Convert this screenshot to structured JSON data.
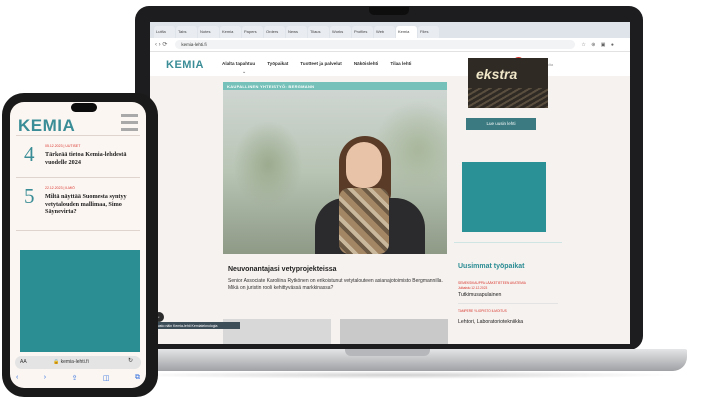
{
  "browser": {
    "tabs": [
      "Lutfia",
      "Tabs",
      "Notes",
      "Kemia",
      "Papers",
      "Orders",
      "News",
      "Tilaus",
      "Works",
      "Profiles",
      "Web",
      "Kemia",
      "Files"
    ],
    "url": "kemia-lehti.fi",
    "nav_glyphs": "‹ › ⟳",
    "toolbar_glyphs": "☆ ⊕ ▣ ●"
  },
  "site": {
    "logo": "KEMIA",
    "nav": [
      "Alalta tapahtuu",
      "Työpaikat",
      "Tuotteet ja palvelut",
      "Näköislehti",
      "Tilaa lehti"
    ],
    "search_placeholder": "Hae sivustolta",
    "hero_label": "KAUPALLINEN YHTEISTYÖ: BERGMANN",
    "hero_title": "Neuvonantajasi vetyprojekteissa",
    "hero_desc": "Senior Associate Karoliina Rytkönen on erikoistunut vetytalouteen asianajotoimisto Bergmannilla. Mikä on juristin rooli kehittyvässä markkinassa?",
    "toast": "Sivusto näin Kemia-lehti Kemiateknologia",
    "ad_brand": "ekstra",
    "read_button": "Lue uusin lehti",
    "jobs_title": "Uusimmat työpaikat",
    "jobs": [
      {
        "meta": "SEMEKSIKAUPPA LÄÄKETIETEEN AKATEMIA",
        "date": "Julkaistu 12.12.2023",
        "title": "Tutkimusapulainen"
      },
      {
        "meta": "TAMPERE YLIOPISTO ILMOITUS",
        "date": "",
        "title": "Lehtori, Laboratoriotekniikka"
      }
    ]
  },
  "phone": {
    "logo": "KEMIA",
    "articles": [
      {
        "rank": "4",
        "meta": "05.12.2023 | UUTISET",
        "title": "Tärkeää tietoa Kemia-lehdestä vuodelle 2024"
      },
      {
        "rank": "5",
        "meta": "22.12.2023 | ILMIÖ",
        "title": "Miltä näyttää Suomesta syntyy vetytalouden mallimaa, Simo Säynevirta?"
      }
    ],
    "aa": "AA",
    "url": "🔒 kemia-lehti.fi",
    "reload": "↻",
    "toolbar": [
      "‹",
      "›",
      "⇪",
      "◫",
      "⧉"
    ]
  },
  "colors": {
    "brand_teal": "#3a8d96",
    "accent_red": "#d8342b",
    "ad_teal": "#2a9297"
  }
}
